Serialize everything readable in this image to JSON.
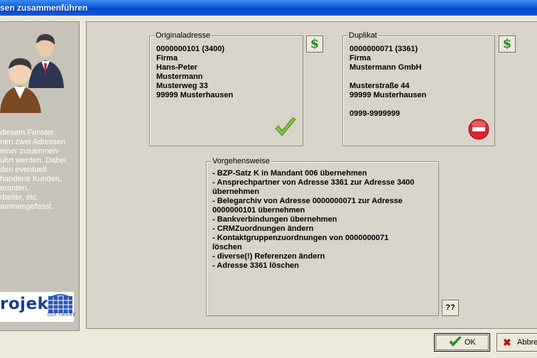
{
  "window": {
    "title": "sen zusammenführen"
  },
  "sidebar": {
    "description": "diesem Fenster\nnen zwei Adressen\neiner zusammen-\nührt werden. Dabei\nden eventuell\nhandene Kunden,\neranten,\nrbeiter, etc.\nammengefasst.",
    "logo_text": "rojekt",
    "logo_sub": "SOFTWARE"
  },
  "original": {
    "legend": "Originaladresse",
    "lines": [
      "0000000101 (3400)",
      "Firma",
      "Hans-Peter",
      "Mustermann",
      "Musterweg 33",
      "99999 Musterhausen"
    ],
    "money_icon": "$"
  },
  "duplicate": {
    "legend": "Duplikat",
    "lines": [
      "0000000071 (3361)",
      "Firma",
      "Mustermann GmbH",
      "",
      "Musterstraße 44",
      "99999 Musterhausen",
      "",
      "0999-9999999"
    ],
    "money_icon": "$"
  },
  "procedure": {
    "legend": "Vorgehensweise",
    "lines": [
      "- BZP-Satz K in Mandant 006 übernehmen",
      "- Ansprechpartner von Adresse 3361 zur Adresse 3400",
      "übernehmen",
      "- Belegarchiv von Adresse 0000000071 zur Adresse",
      "0000000101 übernehmen",
      "- Bankverbindungen übernehmen",
      "- CRMZuordnungen ändern",
      "- Kontaktgruppenzuordnungen von 0000000071",
      "löschen",
      "- diverse(!) Referenzen ändern",
      "- Adresse 3361 löschen"
    ]
  },
  "help_button": {
    "label": "??"
  },
  "buttons": {
    "ok": "OK",
    "cancel": "Abbre"
  },
  "colors": {
    "titlebar": "#0a5fd9",
    "accept": "#7cc242",
    "reject": "#d9262c"
  }
}
